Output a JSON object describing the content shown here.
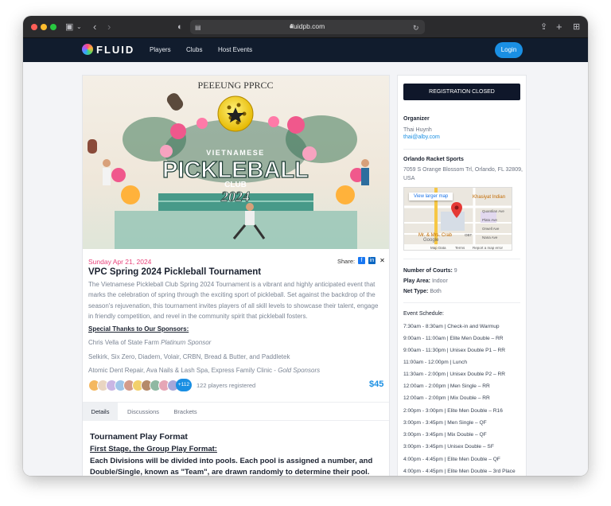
{
  "browser": {
    "url": "fluidpb.com"
  },
  "nav": {
    "logo": "FLUID",
    "links": [
      "Players",
      "Clubs",
      "Host Events"
    ],
    "login": "Login"
  },
  "hero": {
    "arc_text": "PEEEUNG PPRCC",
    "top_line": "VIETNAMESE",
    "main_word": "PICKLEBALL",
    "club_word": "CLUB",
    "year": "2024"
  },
  "event": {
    "date": "Sunday Apr 21, 2024",
    "share_label": "Share:",
    "title": "VPC Spring 2024 Pickleball Tournament",
    "description": "The Vietnamese Pickleball Club Spring 2024 Tournament is a vibrant and highly anticipated event that marks the celebration of spring through the exciting sport of pickleball. Set against the backdrop of the season's rejuvenation, this tournament invites players of all skill levels to showcase their talent, engage in friendly competition, and revel in the community spirit that pickleball fosters.",
    "sponsors_heading": "Special Thanks to Our Sponsors:",
    "sponsor_1_name": "Chris Vella of State Farm",
    "sponsor_1_tier": "Platinum Sponsor",
    "sponsor_2": "Selkirk, Six Zero, Diadem, Volair, CRBN, Bread & Butter, and Paddletek",
    "sponsor_3_names": "Atomic Dent Repair, Ava Nails & Lash Spa, Express Family Clinic -",
    "sponsor_3_tier": "Gold Sponsors",
    "more_players": "+112",
    "registered": "122 players registered",
    "price": "$45"
  },
  "tabs": [
    "Details",
    "Discussions",
    "Brackets"
  ],
  "details": {
    "heading": "Tournament Play Format",
    "stage_title": "First Stage, the Group Play Format:",
    "stage_body": "Each Divisions will be divided into pools. Each pool is assigned a number, and Double/Single, known as \"Team\", are drawn randomly to determine their pool."
  },
  "sidebar": {
    "registration": "REGISTRATION CLOSED",
    "organizer_label": "Organizer",
    "organizer_name": "Thai Huynh",
    "organizer_email": "thai@alby.com",
    "venue_name": "Orlando Racket Sports",
    "venue_address": "7059 S Orange Blossom Trl, Orlando, FL 32809, USA",
    "map": {
      "button": "View larger map",
      "labels": [
        "Khasiyat Indian",
        "Quantilan Ave",
        "Plato Ave",
        "Orwell Ave",
        "Nana Ave",
        "Mr. & Mrs. Crab",
        "OBT",
        "Google"
      ],
      "footer": [
        "Map Data",
        "Terms",
        "Report a map error"
      ]
    },
    "courts_label": "Number of Courts:",
    "courts_value": "9",
    "area_label": "Play Area:",
    "area_value": "Indoor",
    "net_label": "Net Type:",
    "net_value": "Both",
    "schedule_label": "Event Schedule:",
    "schedule": [
      "7:30am - 8:30am | Check-in and Warmup",
      "9:00am - 11:00am | Elite Men Double – RR",
      "9:00am - 11:30pm | Unisex Double P1 – RR",
      "11:00am - 12:00pm | Lunch",
      "11:30am - 2:00pm | Unisex Double P2 – RR",
      "12:00am - 2:00pm | Men Single – RR",
      "12:00am - 2:00pm | Mix Double – RR",
      "2:00pm - 3:00pm | Elite Men Double – R16",
      "3:00pm - 3:45pm | Men Single – QF",
      "3:00pm - 3:45pm | Mix Double – QF",
      "3:00pm - 3:45pm | Unisex Double – SF",
      "4:00pm - 4:45pm | Elite Men Double – QF",
      "4:00pm - 4:45pm | Elite Men Double – 3rd Place"
    ]
  },
  "colors": {
    "accent": "#1a8fe3",
    "date": "#e8447c",
    "nav_bg": "#111c2d",
    "registration_bg": "#0f172a"
  }
}
